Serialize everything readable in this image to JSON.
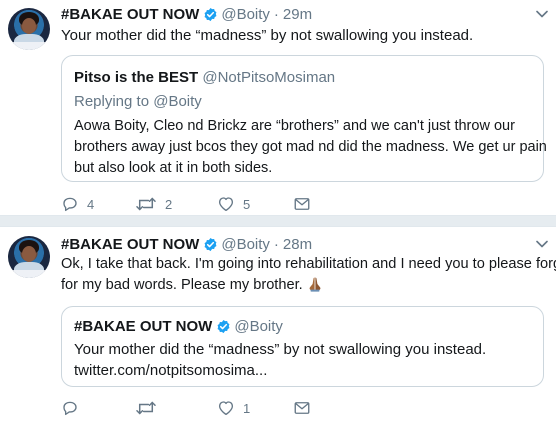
{
  "tweets": [
    {
      "author_name": "#BAKAE OUT NOW",
      "handle": "@Boity",
      "separator": "·",
      "time": "29m",
      "text": "Your mother did the “madness” by not swallowing you instead.",
      "quoted": {
        "author_name": "Pitso is the BEST",
        "handle": "@NotPitsoMosiman",
        "replying_to": "Replying to @Boity",
        "lines": [
          "Aowa Boity, Cleo nd Brickz are “brothers” and we can't just throw our",
          "brothers away just bcos they got mad nd did the madness. We get ur pain",
          "but also look at it in both sides."
        ]
      },
      "actions": {
        "reply_count": "4",
        "retweet_count": "2",
        "like_count": "5"
      }
    },
    {
      "author_name": "#BAKAE OUT NOW",
      "handle": "@Boity",
      "separator": "·",
      "time": "28m",
      "lines": [
        "Ok, I take that back. I'm going into rehabilitation and I need you to please forgive",
        "for my bad words. Please my brother."
      ],
      "emoji": "folded-hands",
      "quoted": {
        "author_name": "#BAKAE OUT NOW",
        "handle": "@Boity",
        "lines": [
          "Your mother did the “madness” by not swallowing you instead.",
          "twitter.com/notpitsomosima..."
        ]
      },
      "actions": {
        "reply_count": "",
        "retweet_count": "",
        "like_count": "1"
      }
    }
  ],
  "colors": {
    "text": "#14171a",
    "secondary": "#657786",
    "verified": "#1da1f2",
    "border": "#ccd6dd",
    "divider": "#e6ecf0"
  },
  "icons": [
    "reply-icon",
    "retweet-icon",
    "like-icon",
    "message-icon",
    "verified-badge-icon",
    "chevron-down-icon"
  ]
}
